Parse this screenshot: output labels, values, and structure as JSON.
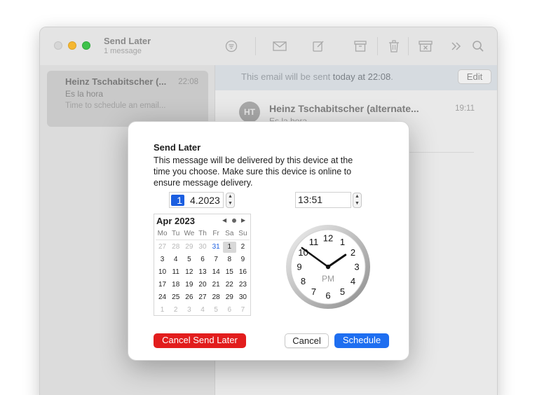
{
  "window": {
    "title": "Send Later",
    "subtitle": "1 message"
  },
  "toolbar": {
    "icons": [
      "filter-icon",
      "envelope-icon",
      "compose-icon",
      "archive-icon",
      "trash-icon",
      "junk-icon",
      "more-icon",
      "search-icon"
    ]
  },
  "sidebar": {
    "message": {
      "from": "Heinz Tschabitscher (...",
      "time": "22:08",
      "subject": "Es la hora",
      "preview": "Time to schedule an email..."
    }
  },
  "content": {
    "banner_prefix": "This email will be sent ",
    "banner_strong": "today at 22:08",
    "banner_suffix": ".",
    "edit_label": "Edit",
    "avatar_initials": "HT",
    "from": "Heinz Tschabitscher (alternate...",
    "time": "19:11",
    "subject": "Es la hora"
  },
  "dialog": {
    "title": "Send Later",
    "description": "This message will be delivered by this device at the time you choose. Make sure this device is online to ensure message delivery.",
    "date_day": "1",
    "date_rest": "4.2023",
    "time_value": "13:51",
    "calendar": {
      "month_label": "Apr 2023",
      "weekdays": [
        "Mo",
        "Tu",
        "We",
        "Th",
        "Fr",
        "Sa",
        "Su"
      ],
      "days": [
        "27",
        "28",
        "29",
        "30",
        "31",
        "1",
        "2",
        "3",
        "4",
        "5",
        "6",
        "7",
        "8",
        "9",
        "10",
        "11",
        "12",
        "13",
        "14",
        "15",
        "16",
        "17",
        "18",
        "19",
        "20",
        "21",
        "22",
        "23",
        "24",
        "25",
        "26",
        "27",
        "28",
        "29",
        "30",
        "1",
        "2",
        "3",
        "4",
        "5",
        "6",
        "7"
      ],
      "today_index": 4,
      "selected_index": 5
    },
    "clock": {
      "numbers": [
        "12",
        "1",
        "2",
        "3",
        "4",
        "5",
        "6",
        "7",
        "8",
        "9",
        "10",
        "11"
      ],
      "period": "PM",
      "hour": 13,
      "minute": 51
    },
    "cancel_send_later_label": "Cancel Send Later",
    "cancel_label": "Cancel",
    "schedule_label": "Schedule"
  },
  "colors": {
    "accent": "#1e6ef0",
    "destructive": "#e21d1d",
    "selected_field": "#1b5ee0"
  }
}
